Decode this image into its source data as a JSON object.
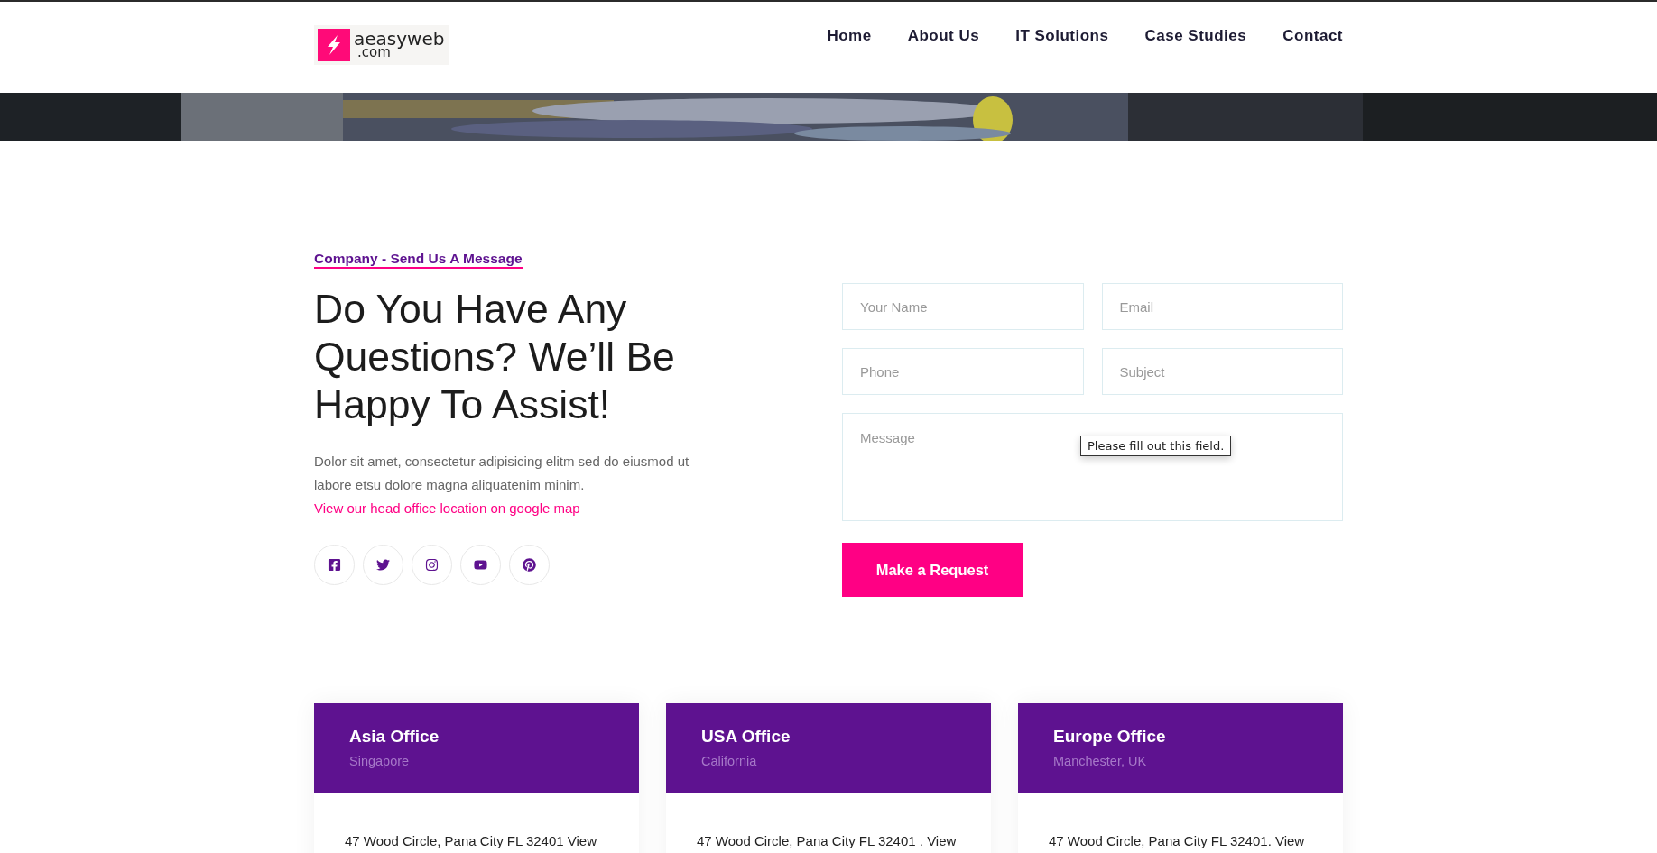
{
  "logo": {
    "name": "aeasyweb",
    "domain": ".com"
  },
  "nav": [
    {
      "label": "Home"
    },
    {
      "label": "About Us"
    },
    {
      "label": "IT Solutions"
    },
    {
      "label": "Case Studies"
    },
    {
      "label": "Contact"
    }
  ],
  "contact": {
    "tagline": "Company - Send Us A Message",
    "heading": "Do You Have Any Questions? We’ll Be Happy To Assist!",
    "text": "Dolor sit amet, consectetur adipisicing elitm sed do eiusmod ut labore etsu dolore magna aliquatenim minim.",
    "link": "View our head office location on google map",
    "socials": [
      {
        "kind": "facebook"
      },
      {
        "kind": "twitter"
      },
      {
        "kind": "instagram"
      },
      {
        "kind": "youtube"
      },
      {
        "kind": "pinterest"
      }
    ]
  },
  "form": {
    "fields": [
      {
        "placeholder": "Your Name"
      },
      {
        "placeholder": "Email"
      },
      {
        "placeholder": "Phone"
      },
      {
        "placeholder": "Subject"
      }
    ],
    "message": {
      "placeholder": "Message"
    },
    "tooltip": "Please fill out this field.",
    "button": "Make a Request"
  },
  "offices": [
    {
      "title": "Asia Office",
      "place": "Singapore",
      "address": "47 Wood Circle, Pana City FL 32401 View"
    },
    {
      "title": "USA Office",
      "place": "California",
      "address": "47 Wood Circle, Pana City FL 32401 . View"
    },
    {
      "title": "Europe Office",
      "place": "Manchester, UK",
      "address": "47 Wood Circle, Pana City FL 32401. View"
    }
  ]
}
